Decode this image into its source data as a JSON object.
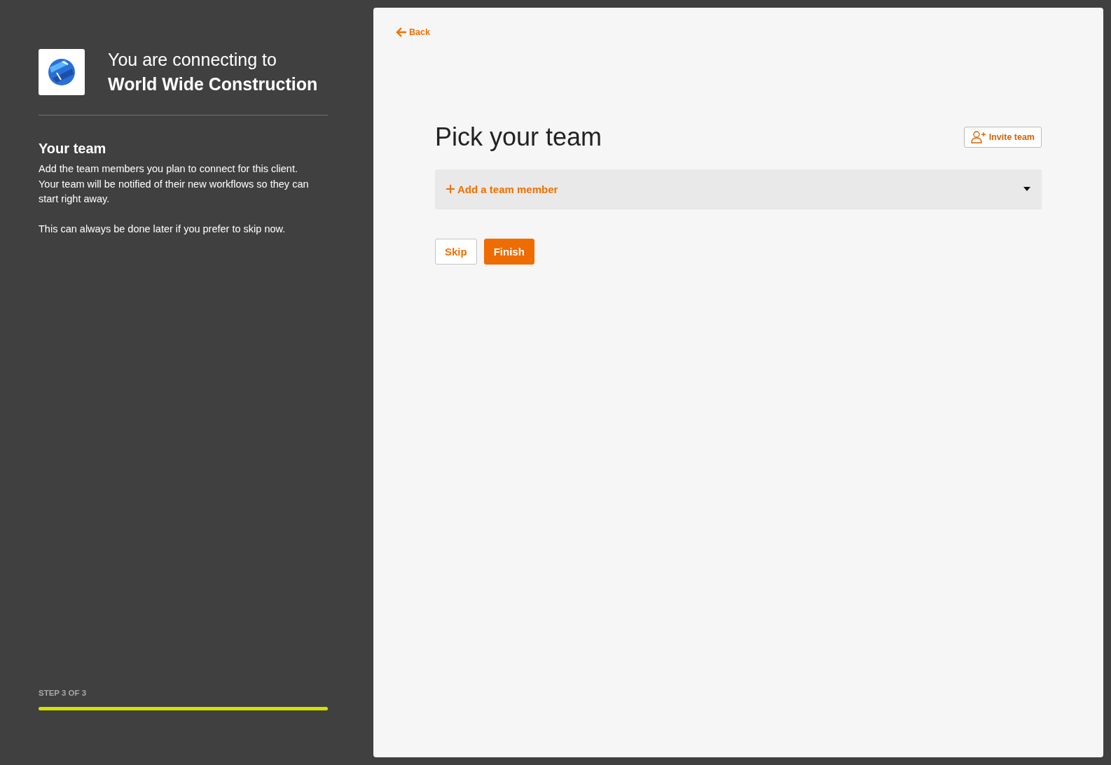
{
  "sidebar": {
    "heading_prefix": "You are connecting to",
    "client_name": "World Wide Construction",
    "section_title": "Your team",
    "paragraphs": [
      "Add the team members you plan to connect for this client. Your team will be notified of their new workflows so they can start right away.",
      "This can always be done later if you prefer to skip now."
    ],
    "step_label": "STEP 3 OF 3",
    "progress": {
      "level": 1
    }
  },
  "main": {
    "back_link": "Back",
    "title": "Pick your team",
    "invite_button": "Invite team",
    "add_member": {
      "label": "Add a team member",
      "expanded": false
    },
    "buttons": [
      {
        "label": "Skip",
        "kind": "secondary"
      },
      {
        "label": "Finish",
        "kind": "primary"
      }
    ]
  }
}
